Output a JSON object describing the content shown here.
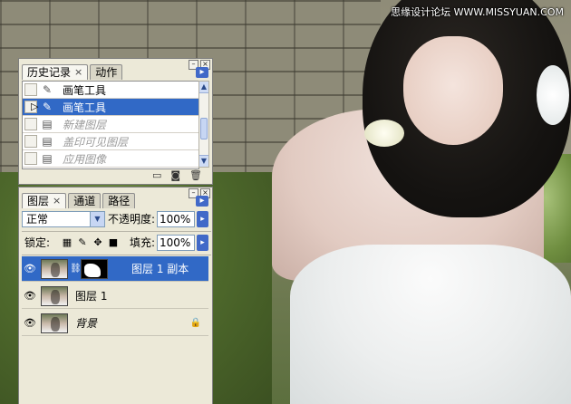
{
  "watermark": "思缘设计论坛 WWW.MISSYUAN.COM",
  "history_panel": {
    "tabs": [
      {
        "label": "历史记录",
        "active": true
      },
      {
        "label": "动作",
        "active": false
      }
    ],
    "items": [
      {
        "label": "画笔工具",
        "state": "normal"
      },
      {
        "label": "画笔工具",
        "state": "selected"
      },
      {
        "label": "新建图层",
        "state": "disabled"
      },
      {
        "label": "盖印可见图层",
        "state": "disabled"
      },
      {
        "label": "应用图像",
        "state": "disabled"
      }
    ]
  },
  "layers_panel": {
    "tabs": [
      {
        "label": "图层",
        "active": true
      },
      {
        "label": "通道",
        "active": false
      },
      {
        "label": "路径",
        "active": false
      }
    ],
    "blend_mode": "正常",
    "opacity_label": "不透明度:",
    "opacity_value": "100%",
    "lock_label": "锁定:",
    "fill_label": "填充:",
    "fill_value": "100%",
    "layers": [
      {
        "name": "图层 1 副本",
        "selected": true,
        "has_mask": true
      },
      {
        "name": "图层 1",
        "selected": false,
        "has_mask": false
      },
      {
        "name": "背景",
        "selected": false,
        "locked": true
      }
    ]
  },
  "colors": {
    "selection": "#3169c6",
    "panel_bg": "#ece9d8"
  }
}
